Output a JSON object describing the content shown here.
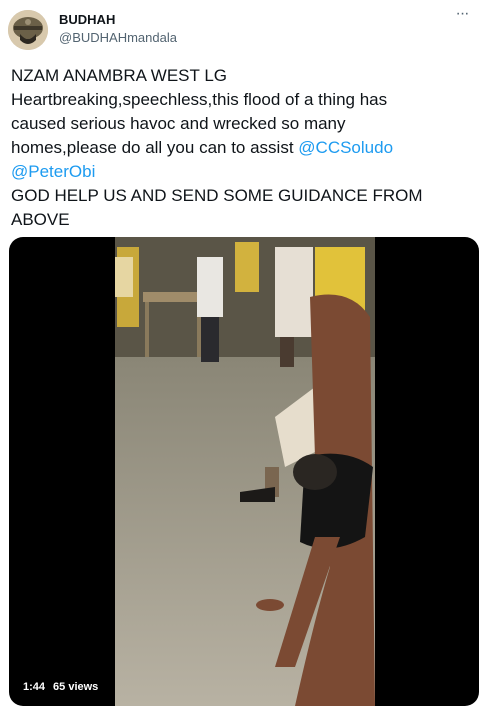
{
  "author": {
    "display_name": "BUDHAH",
    "handle": "@BUDHAHmandala",
    "avatar_icon": "helmet-avatar-icon"
  },
  "menu": {
    "icon": "more-dots-icon",
    "label": "···"
  },
  "tweet": {
    "line1": "NZAM ANAMBRA WEST LG",
    "line2": "Heartbreaking,speechless,this flood of a thing has",
    "line3": "caused serious havoc and wrecked so many",
    "line4_prefix": "homes,please do all you can to assist ",
    "mention1": "@CCSoludo",
    "mention2": "@PeterObi",
    "line6": "GOD HELP US AND SEND SOME GUIDANCE FROM",
    "line7": "ABOVE"
  },
  "video": {
    "duration": "1:44",
    "views": "65 views"
  },
  "colors": {
    "link": "#1d9bf0",
    "text": "#0f1419",
    "secondary": "#536471"
  }
}
